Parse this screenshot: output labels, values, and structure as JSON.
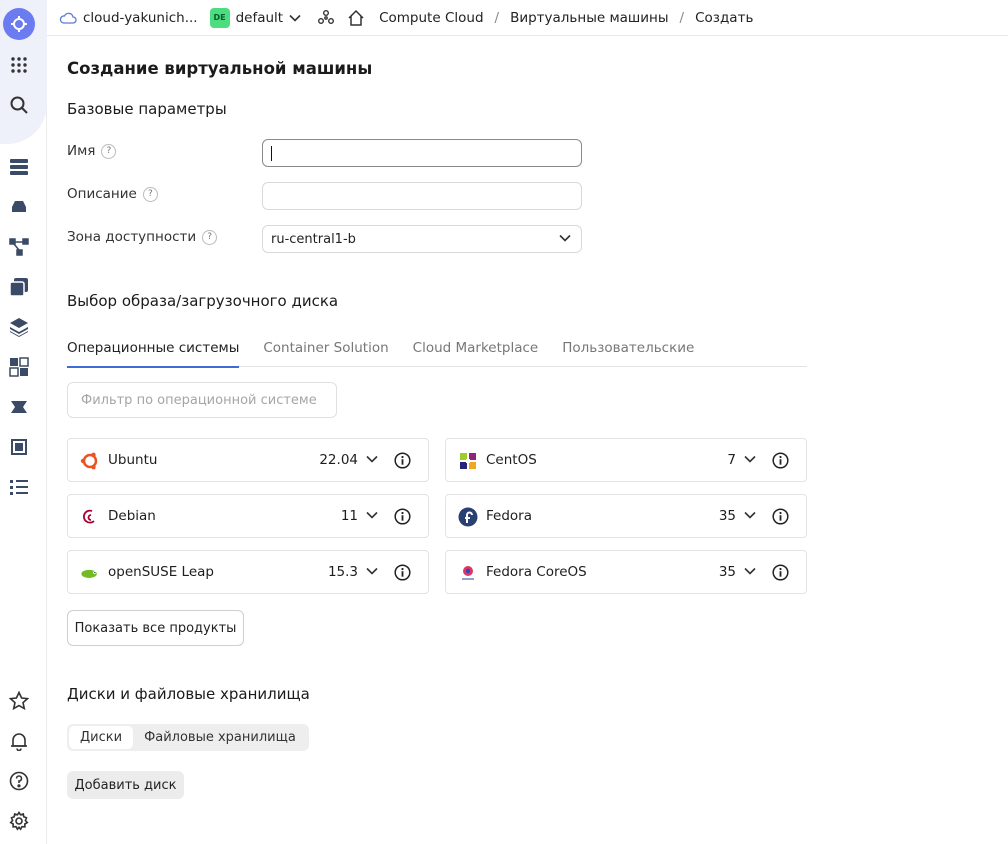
{
  "topbar": {
    "cloud_name": "cloud-yakunich...",
    "folder_badge": "DE",
    "folder_name": "default",
    "breadcrumbs": [
      "Compute Cloud",
      "Виртуальные машины",
      "Создать"
    ],
    "separator": "/"
  },
  "page_title": "Создание виртуальной машины",
  "basic": {
    "title": "Базовые параметры",
    "name_label": "Имя",
    "name_value": "",
    "description_label": "Описание",
    "description_value": "",
    "zone_label": "Зона доступности",
    "zone_value": "ru-central1-b",
    "help": "?"
  },
  "image": {
    "title": "Выбор образа/загрузочного диска",
    "tabs": [
      "Операционные системы",
      "Container Solution",
      "Cloud Marketplace",
      "Пользовательские"
    ],
    "active_tab": 0,
    "filter_placeholder": "Фильтр по операционной системе",
    "os": [
      {
        "name": "Ubuntu",
        "version": "22.04",
        "icon": "ubuntu-logo"
      },
      {
        "name": "CentOS",
        "version": "7",
        "icon": "centos-logo"
      },
      {
        "name": "Debian",
        "version": "11",
        "icon": "debian-logo"
      },
      {
        "name": "Fedora",
        "version": "35",
        "icon": "fedora-logo"
      },
      {
        "name": "openSUSE Leap",
        "version": "15.3",
        "icon": "opensuse-logo"
      },
      {
        "name": "Fedora CoreOS",
        "version": "35",
        "icon": "fedora-coreos-logo"
      }
    ],
    "show_all_label": "Показать все продукты"
  },
  "disks": {
    "title": "Диски и файловые хранилища",
    "segments": [
      "Диски",
      "Файловые хранилища"
    ],
    "add_disk_label": "Добавить диск"
  },
  "colors": {
    "accent": "#3d6bd8",
    "brand": "#6b7cf0",
    "folder_badge": "#4ade80"
  }
}
